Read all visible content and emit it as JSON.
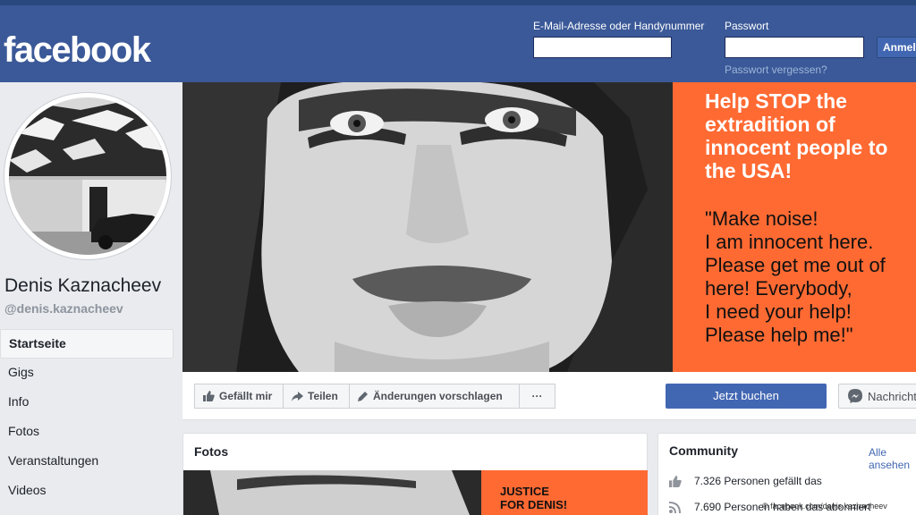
{
  "header": {
    "logo": "facebook",
    "email_label": "E-Mail-Adresse oder Handynummer",
    "password_label": "Passwort",
    "forgot_password": "Passwort vergessen?",
    "login_button": "Anmelden"
  },
  "profile": {
    "name": "Denis Kaznacheev",
    "handle": "@denis.kaznacheev"
  },
  "nav": {
    "items": [
      {
        "label": "Startseite",
        "active": true
      },
      {
        "label": "Gigs"
      },
      {
        "label": "Info"
      },
      {
        "label": "Fotos"
      },
      {
        "label": "Veranstaltungen"
      },
      {
        "label": "Videos"
      }
    ]
  },
  "cover": {
    "headline": "Help STOP the extradition of innocent people to the USA!",
    "quote": "\"Make noise!\nI am innocent here.\nPlease get me out of here! Everybody,\nI need your help!\nPlease help me!\""
  },
  "actions": {
    "like": "Gefällt mir",
    "share": "Teilen",
    "suggest_edits": "Änderungen vorschlagen",
    "more": "···",
    "book_now": "Jetzt buchen",
    "message": "Nachricht"
  },
  "photos_card": {
    "title": "Fotos",
    "banner_text": "JUSTICE\nFOR DENIS!"
  },
  "community_card": {
    "title": "Community",
    "see_all": "Alle ansehen",
    "likes": "7.326 Personen gefällt das",
    "followers": "7.690 Personen haben das abonniert"
  },
  "credit": "© facebook.com/denis.kaznacheev",
  "colors": {
    "facebook_blue": "#3b5998",
    "button_blue": "#4267b2",
    "cover_orange": "#ff6a33"
  }
}
